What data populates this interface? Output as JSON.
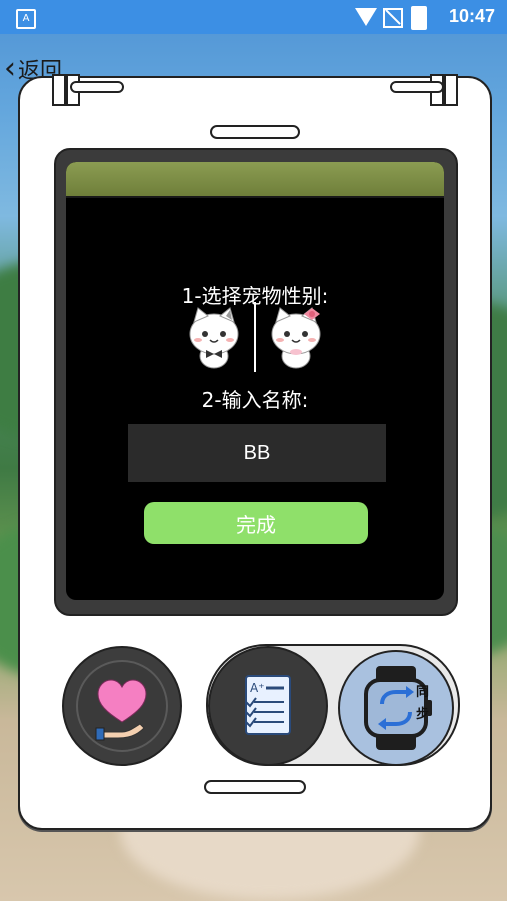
{
  "status_bar": {
    "time": "10:47",
    "left_icon": "A"
  },
  "nav": {
    "back_label": "返回"
  },
  "setup": {
    "step1_label": "1-选择宠物性别:",
    "step2_label": "2-输入名称:",
    "name_value": "BB",
    "done_label": "完成"
  },
  "controls": {
    "sync_label_1": "同",
    "sync_label_2": "步"
  },
  "colors": {
    "accent_green": "#8fe06a",
    "screen_bar": "#7b8c46",
    "status_bar": "#3c8fe4"
  }
}
